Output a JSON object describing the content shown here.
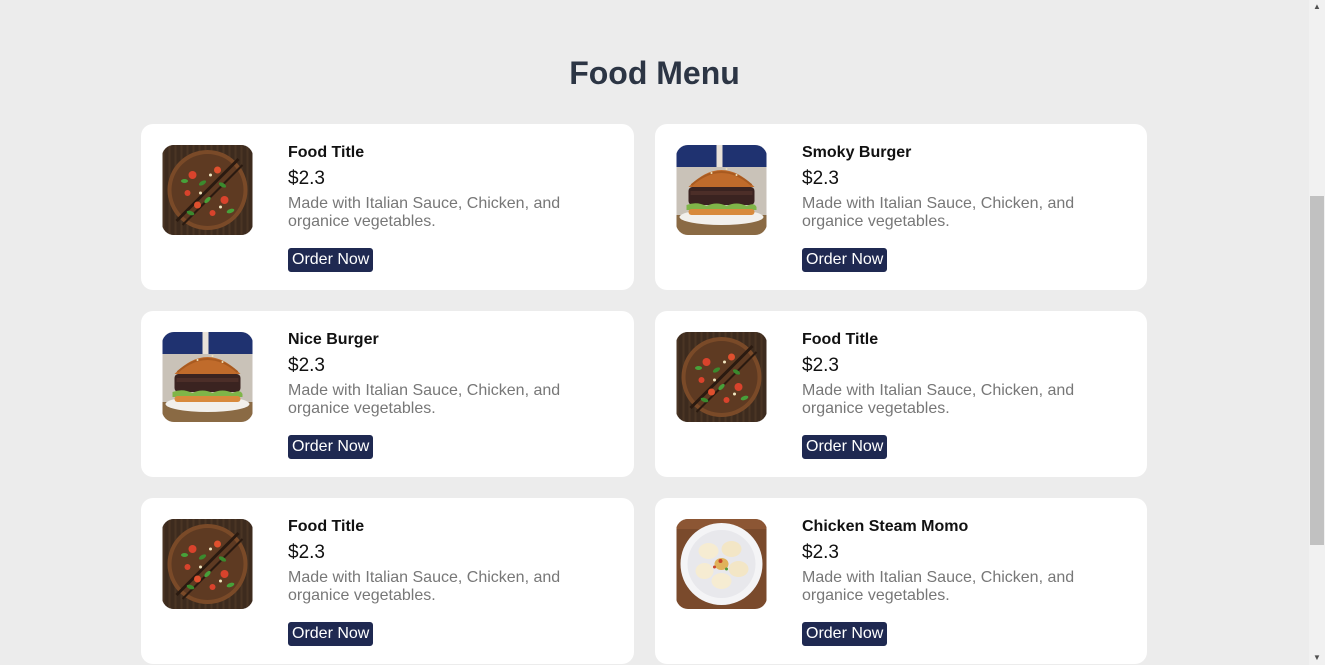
{
  "page": {
    "title": "Food Menu"
  },
  "menu": {
    "items": [
      {
        "title": "Food Title",
        "price": "$2.3",
        "description": "Made with Italian Sauce, Chicken, and organice vegetables.",
        "button_label": "Order Now",
        "image": "pizza-image"
      },
      {
        "title": "Smoky Burger",
        "price": "$2.3",
        "description": "Made with Italian Sauce, Chicken, and organice vegetables.",
        "button_label": "Order Now",
        "image": "burger-image"
      },
      {
        "title": "Nice Burger",
        "price": "$2.3",
        "description": "Made with Italian Sauce, Chicken, and organice vegetables.",
        "button_label": "Order Now",
        "image": "burger-image"
      },
      {
        "title": "Food Title",
        "price": "$2.3",
        "description": "Made with Italian Sauce, Chicken, and organice vegetables.",
        "button_label": "Order Now",
        "image": "pizza-image"
      },
      {
        "title": "Food Title",
        "price": "$2.3",
        "description": "Made with Italian Sauce, Chicken, and organice vegetables.",
        "button_label": "Order Now",
        "image": "pizza-image"
      },
      {
        "title": "Chicken Steam Momo",
        "price": "$2.3",
        "description": "Made with Italian Sauce, Chicken, and organice vegetables.",
        "button_label": "Order Now",
        "image": "momo-image"
      }
    ]
  },
  "colors": {
    "background": "#ececec",
    "card": "#ffffff",
    "title_text": "#2c3544",
    "button": "#1f2951",
    "description_text": "#777777"
  },
  "scrollbar": {
    "up_icon": "scroll-up-arrow-icon",
    "down_icon": "scroll-down-arrow-icon"
  }
}
